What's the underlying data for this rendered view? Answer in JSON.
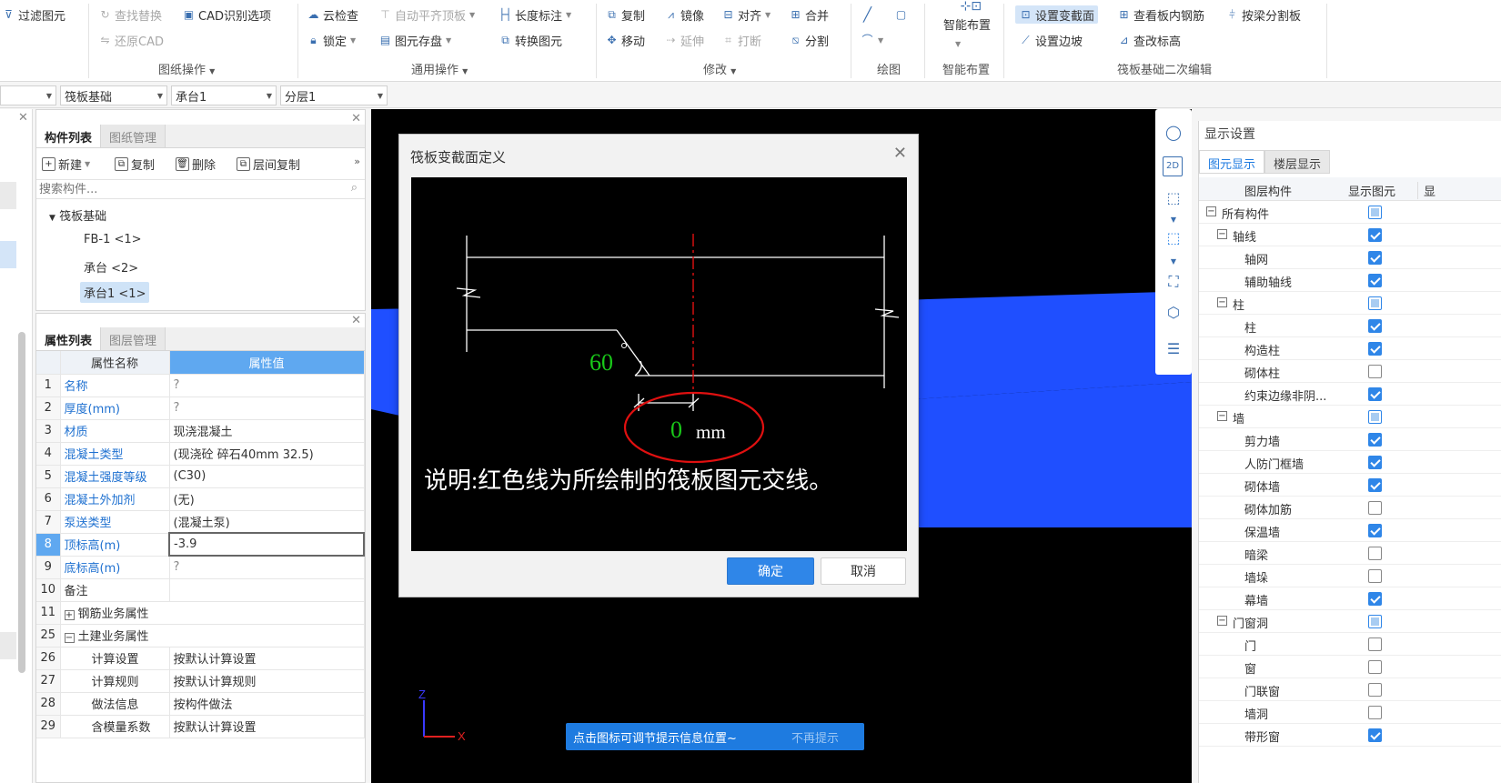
{
  "ribbon": {
    "g1": {
      "b1": "过滤图元",
      "b2": "查找替换",
      "b3": "CAD识别选项",
      "b4": "还原CAD",
      "group": "图纸操作"
    },
    "g2": {
      "b1": "云检查",
      "b2": "自动平齐顶板",
      "b3": "长度标注",
      "b4": "锁定",
      "b5": "图元存盘",
      "b6": "转换图元",
      "group": "通用操作"
    },
    "g3": {
      "b1": "复制",
      "b2": "镜像",
      "b3": "对齐",
      "b4": "合并",
      "b5": "移动",
      "b6": "延伸",
      "b7": "打断",
      "b8": "分割",
      "group": "修改"
    },
    "g4": {
      "group": "绘图"
    },
    "g5": {
      "b1": "智能布置",
      "group": "智能布置"
    },
    "g6": {
      "b1": "设置变截面",
      "b2": "查看板内钢筋",
      "b3": "按梁分割板",
      "b4": "设置边坡",
      "b5": "查改标高",
      "group": "筏板基础二次编辑"
    }
  },
  "filterbar": {
    "f2": "筏板基础",
    "f3": "承台1",
    "f4": "分层1"
  },
  "component_panel": {
    "tab_list": "构件列表",
    "tab_drawing": "图纸管理",
    "new": "新建",
    "copy": "复制",
    "delete": "删除",
    "floor_copy": "层间复制",
    "search_placeholder": "搜索构件...",
    "tree_root": "筏板基础",
    "items": [
      "FB-1 <1>",
      "承台 <2>",
      "承台1 <1>"
    ]
  },
  "property_panel": {
    "tab_props": "属性列表",
    "tab_layers": "图层管理",
    "col_name": "属性名称",
    "col_value": "属性值",
    "rows": [
      {
        "n": "1",
        "name": "名称",
        "value": "?"
      },
      {
        "n": "2",
        "name": "厚度(mm)",
        "value": "?"
      },
      {
        "n": "3",
        "name": "材质",
        "value": "现浇混凝土"
      },
      {
        "n": "4",
        "name": "混凝土类型",
        "value": "(现浇砼 碎石40mm 32.5)"
      },
      {
        "n": "5",
        "name": "混凝土强度等级",
        "value": "(C30)"
      },
      {
        "n": "6",
        "name": "混凝土外加剂",
        "value": "(无)"
      },
      {
        "n": "7",
        "name": "泵送类型",
        "value": "(混凝土泵)"
      },
      {
        "n": "8",
        "name": "顶标高(m)",
        "value": "-3.9"
      },
      {
        "n": "9",
        "name": "底标高(m)",
        "value": "?"
      },
      {
        "n": "10",
        "name": "备注",
        "value": ""
      },
      {
        "n": "11",
        "name": "钢筋业务属性",
        "value": ""
      },
      {
        "n": "25",
        "name": "土建业务属性",
        "value": ""
      },
      {
        "n": "26",
        "name": "计算设置",
        "value": "按默认计算设置"
      },
      {
        "n": "27",
        "name": "计算规则",
        "value": "按默认计算规则"
      },
      {
        "n": "28",
        "name": "做法信息",
        "value": "按构件做法"
      },
      {
        "n": "29",
        "name": "含模量系数",
        "value": "按默认计算设置"
      }
    ]
  },
  "dialog": {
    "title": "筏板变截面定义",
    "angle": "60",
    "offset_value": "0",
    "offset_unit": "mm",
    "note": "说明:红色线为所绘制的筏板图元交线。",
    "ok": "确定",
    "cancel": "取消"
  },
  "display_panel": {
    "title": "显示设置",
    "tab1": "图元显示",
    "tab2": "楼层显示",
    "col1": "图层构件",
    "col2": "显示图元",
    "col3": "显",
    "rows": [
      {
        "label": "所有构件",
        "level": 0,
        "state": "part",
        "exp": "-"
      },
      {
        "label": "轴线",
        "level": 1,
        "state": "on",
        "exp": "-"
      },
      {
        "label": "轴网",
        "level": 2,
        "state": "on"
      },
      {
        "label": "辅助轴线",
        "level": 2,
        "state": "on"
      },
      {
        "label": "柱",
        "level": 1,
        "state": "part",
        "exp": "-"
      },
      {
        "label": "柱",
        "level": 2,
        "state": "on"
      },
      {
        "label": "构造柱",
        "level": 2,
        "state": "on"
      },
      {
        "label": "砌体柱",
        "level": 2,
        "state": "off"
      },
      {
        "label": "约束边缘非阴...",
        "level": 2,
        "state": "on"
      },
      {
        "label": "墙",
        "level": 1,
        "state": "part",
        "exp": "-"
      },
      {
        "label": "剪力墙",
        "level": 2,
        "state": "on"
      },
      {
        "label": "人防门框墙",
        "level": 2,
        "state": "on"
      },
      {
        "label": "砌体墙",
        "level": 2,
        "state": "on"
      },
      {
        "label": "砌体加筋",
        "level": 2,
        "state": "off"
      },
      {
        "label": "保温墙",
        "level": 2,
        "state": "on"
      },
      {
        "label": "暗梁",
        "level": 2,
        "state": "off"
      },
      {
        "label": "墙垛",
        "level": 2,
        "state": "off"
      },
      {
        "label": "幕墙",
        "level": 2,
        "state": "on"
      },
      {
        "label": "门窗洞",
        "level": 1,
        "state": "part",
        "exp": "-"
      },
      {
        "label": "门",
        "level": 2,
        "state": "off"
      },
      {
        "label": "窗",
        "level": 2,
        "state": "off"
      },
      {
        "label": "门联窗",
        "level": 2,
        "state": "off"
      },
      {
        "label": "墙洞",
        "level": 2,
        "state": "off"
      },
      {
        "label": "带形窗",
        "level": 2,
        "state": "on"
      }
    ]
  },
  "hint": {
    "text": "点击图标可调节提示信息位置~",
    "dismiss": "不再提示"
  },
  "axes": {
    "z": "Z",
    "x": "X"
  },
  "colors": {
    "accent": "#2f86e8",
    "canvas_blue": "#1f4fff",
    "dialog_green": "#19c819",
    "dialog_red": "#e01010"
  }
}
